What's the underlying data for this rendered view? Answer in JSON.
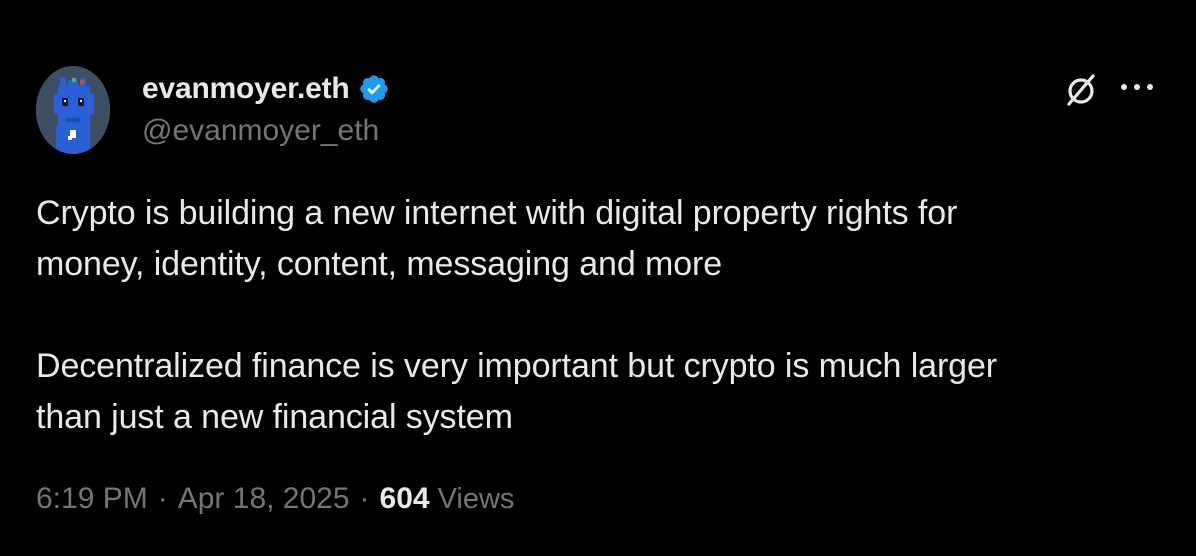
{
  "author": {
    "display_name": "evanmoyer.eth",
    "handle": "@evanmoyer_eth",
    "verified": true
  },
  "tweet": {
    "paragraphs": [
      "Crypto is building a new internet with digital property rights for\nmoney, identity, content, messaging and more",
      "Decentralized finance is very important but crypto is much larger\nthan just a new financial system"
    ],
    "time": "6:19 PM",
    "date": "Apr 18, 2025",
    "separator": "·",
    "views_count": "604",
    "views_label": "Views"
  },
  "icons": {
    "grok": "grok-icon",
    "more": "more-icon",
    "verified": "verified-badge-icon"
  },
  "colors": {
    "background": "#000000",
    "primary_text": "#e7e9ea",
    "secondary_text": "#71767b",
    "verified_blue": "#1d9bf0"
  }
}
